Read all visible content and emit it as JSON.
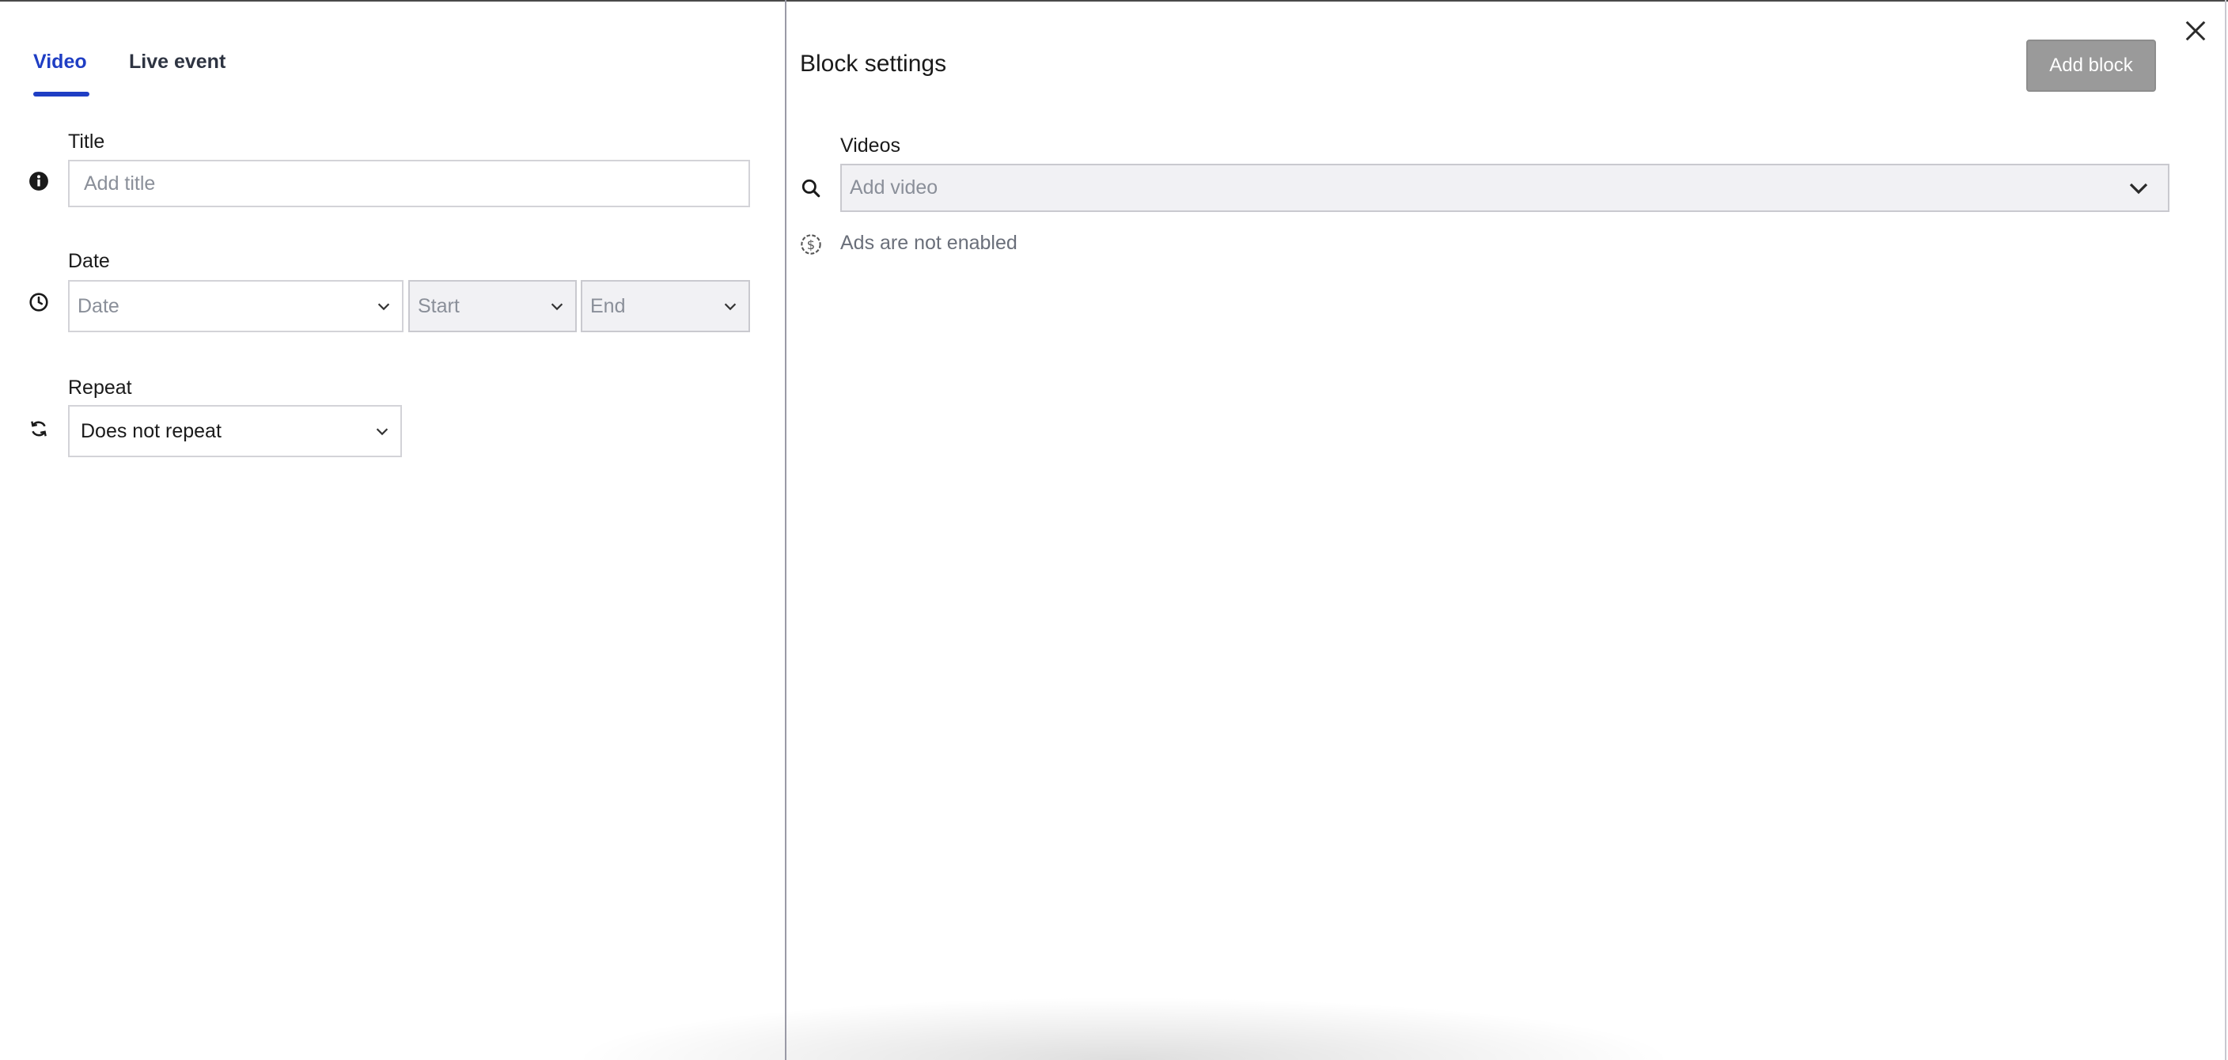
{
  "tabs": [
    {
      "label": "Video",
      "active": true
    },
    {
      "label": "Live event",
      "active": false
    }
  ],
  "form": {
    "title": {
      "label": "Title",
      "placeholder": "Add title"
    },
    "date": {
      "label": "Date",
      "date_placeholder": "Date",
      "start_placeholder": "Start",
      "end_placeholder": "End"
    },
    "repeat": {
      "label": "Repeat",
      "value": "Does not repeat"
    }
  },
  "block_settings": {
    "title": "Block settings",
    "add_button": "Add block",
    "videos_label": "Videos",
    "video_placeholder": "Add video",
    "ads_status": "Ads are not enabled"
  },
  "icons": {
    "title": "info-icon",
    "date": "clock-icon",
    "repeat": "refresh-icon",
    "search": "search-icon",
    "ads": "dollar-circle-icon",
    "close": "close-icon"
  },
  "colors": {
    "accent": "#1f3ec4",
    "button_disabled": "#9a9a9a",
    "field_gray": "#f1f1f4"
  }
}
